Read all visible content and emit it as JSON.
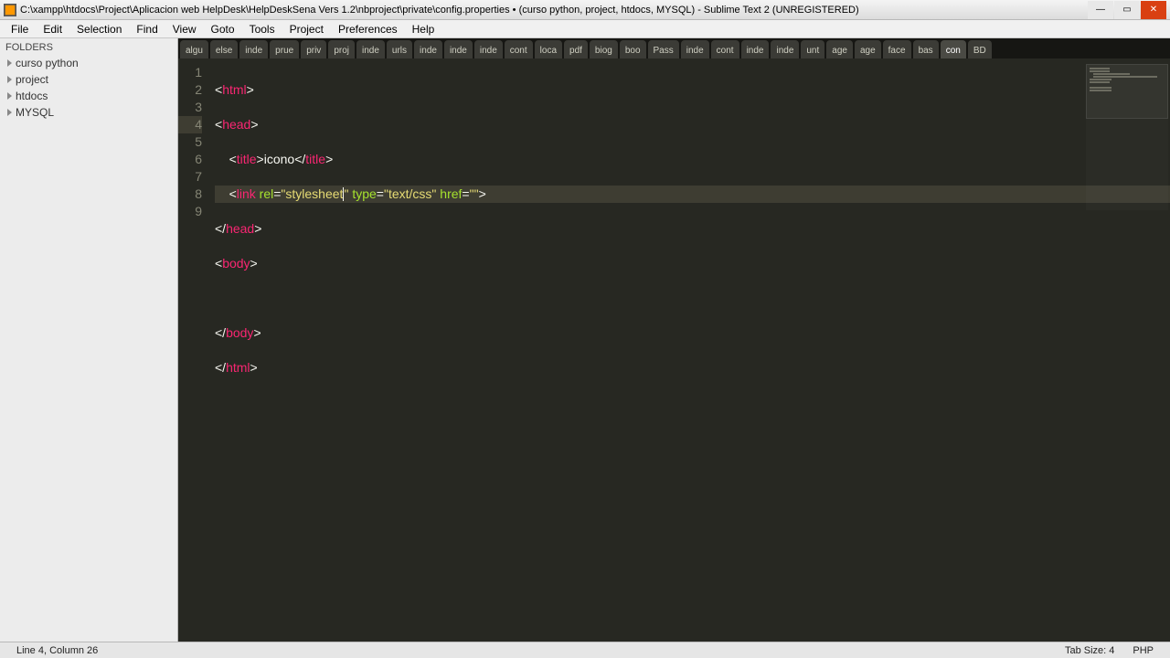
{
  "window": {
    "title": "C:\\xampp\\htdocs\\Project\\Aplicacion web HelpDesk\\HelpDeskSena Vers 1.2\\nbproject\\private\\config.properties • (curso python, project, htdocs, MYSQL) - Sublime Text 2 (UNREGISTERED)"
  },
  "menu": {
    "items": [
      "File",
      "Edit",
      "Selection",
      "Find",
      "View",
      "Goto",
      "Tools",
      "Project",
      "Preferences",
      "Help"
    ]
  },
  "sidebar": {
    "heading": "FOLDERS",
    "folders": [
      "curso python",
      "project",
      "htdocs",
      "MYSQL"
    ]
  },
  "tabs": {
    "items": [
      "algu",
      "else",
      "inde",
      "prue",
      "priv",
      "proj",
      "inde",
      "urls",
      "inde",
      "inde",
      "inde",
      "cont",
      "loca",
      "pdf",
      "biog",
      "boo",
      "Pass",
      "inde",
      "cont",
      "inde",
      "inde",
      "unt",
      "age",
      "age",
      "face",
      "bas",
      "con",
      "BD"
    ],
    "active_index": 26
  },
  "code": {
    "lines": [
      {
        "n": 1
      },
      {
        "n": 2
      },
      {
        "n": 3
      },
      {
        "n": 4
      },
      {
        "n": 5
      },
      {
        "n": 6
      },
      {
        "n": 7
      },
      {
        "n": 8
      },
      {
        "n": 9
      }
    ],
    "content": {
      "line3_text": "icono",
      "line4_rel": "stylesheet",
      "line4_type": "text/css",
      "line4_href": ""
    },
    "current_line": 4
  },
  "status": {
    "left": "Line 4, Column 26",
    "tab_size": "Tab Size: 4",
    "lang": "PHP"
  }
}
